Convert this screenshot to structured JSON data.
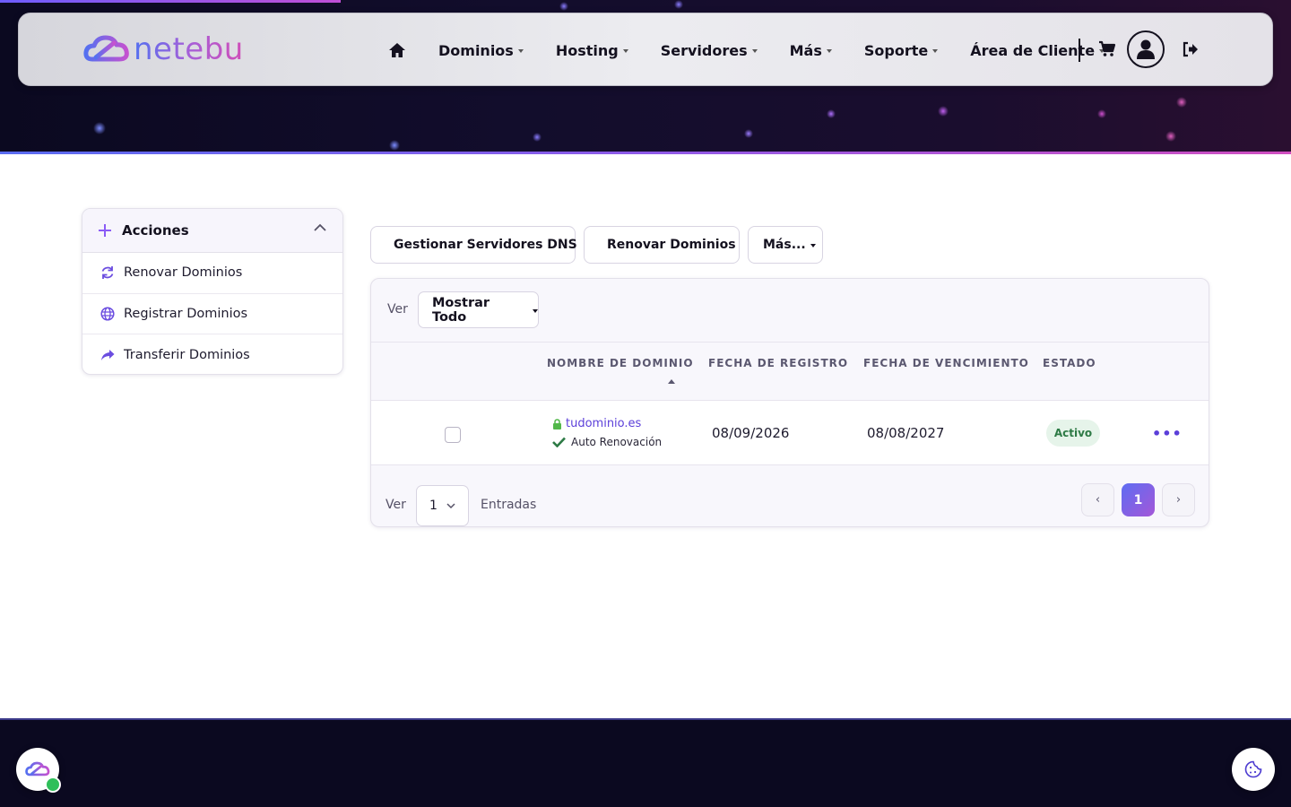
{
  "brand": {
    "name": "netebu"
  },
  "nav": {
    "items": [
      {
        "label": "Dominios"
      },
      {
        "label": "Hosting"
      },
      {
        "label": "Servidores"
      },
      {
        "label": "Más"
      },
      {
        "label": "Soporte"
      },
      {
        "label": "Área de Cliente"
      }
    ]
  },
  "sidebar": {
    "title": "Acciones",
    "items": [
      {
        "label": "Renovar Dominios",
        "icon": "sync-icon"
      },
      {
        "label": "Registrar Dominios",
        "icon": "globe-icon"
      },
      {
        "label": "Transferir Dominios",
        "icon": "share-arrow-icon"
      }
    ]
  },
  "toolbar": {
    "dns_label": "Gestionar Servidores DNS",
    "renew_label": "Renovar Dominios",
    "more_label": "Más..."
  },
  "filter": {
    "view_label": "Ver",
    "selected": "Mostrar Todo"
  },
  "table": {
    "columns": [
      "NOMBRE DE DOMINIO",
      "FECHA DE REGISTRO",
      "FECHA DE VENCIMIENTO",
      "ESTADO"
    ],
    "rows": [
      {
        "domain": "tudominio.es",
        "auto_renew": "Auto Renovación",
        "registered": "08/09/2026",
        "expires": "08/08/2027",
        "status": "Activo"
      }
    ]
  },
  "pagination": {
    "view_label": "Ver",
    "per_page": "1",
    "entries_label": "Entradas",
    "prev": "‹",
    "current": "1",
    "next": "›"
  },
  "colors": {
    "accent": "#5b3fd9",
    "brand_gradient_start": "#5470f0",
    "brand_gradient_end": "#d04eb8",
    "status_active_bg": "#e6f4ea",
    "status_active_text": "#2d7a45"
  }
}
